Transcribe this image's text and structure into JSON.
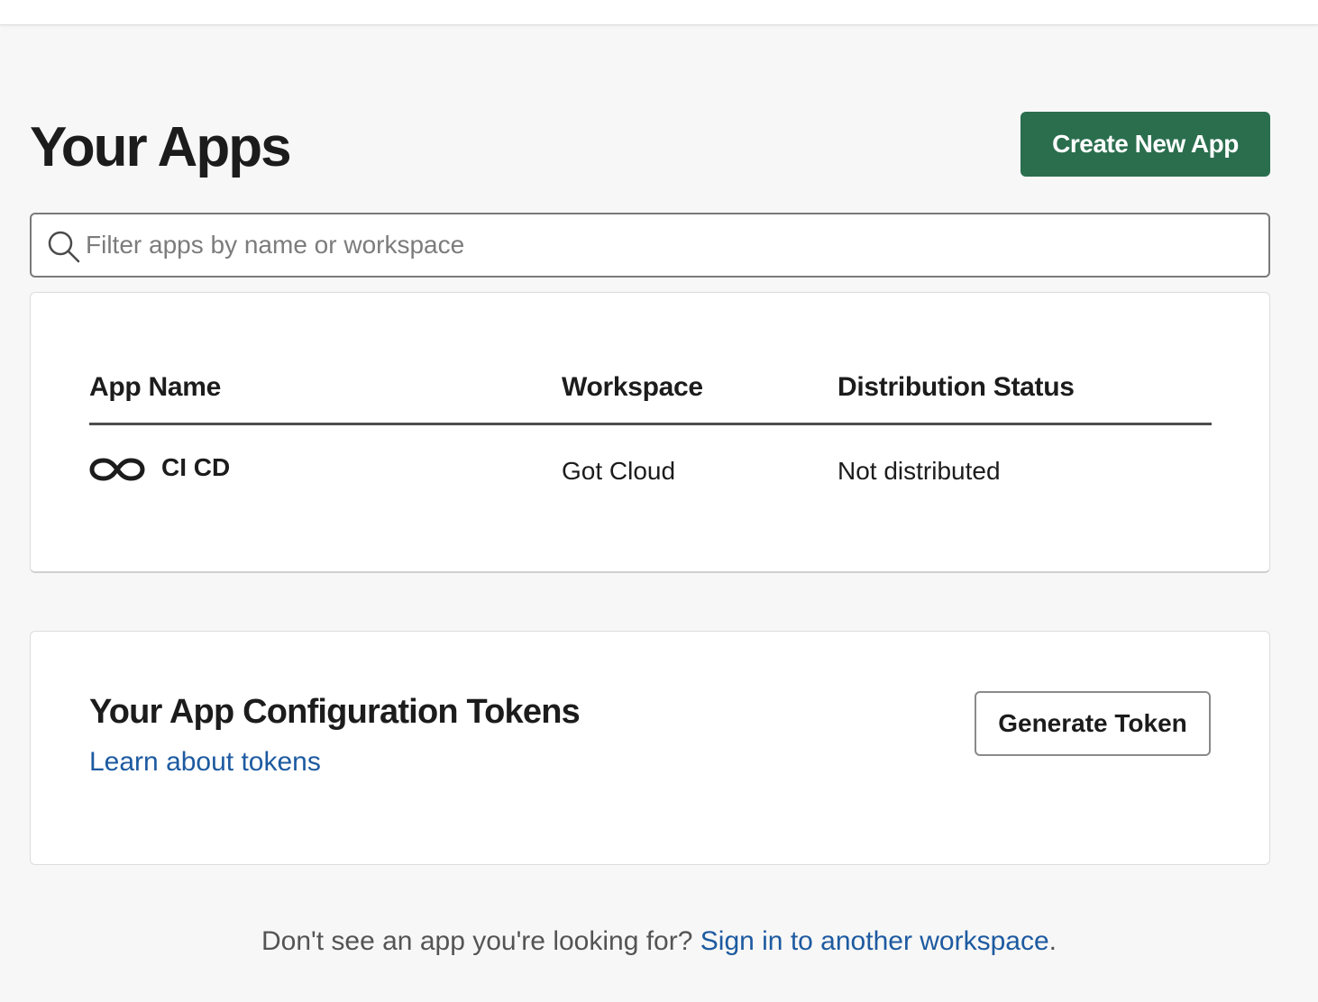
{
  "page": {
    "title": "Your Apps",
    "create_button_label": "Create New App"
  },
  "search": {
    "placeholder": "Filter apps by name or workspace",
    "value": "",
    "icon": "search-icon"
  },
  "apps_table": {
    "columns": [
      "App Name",
      "Workspace",
      "Distribution Status"
    ],
    "rows": [
      {
        "icon": "infinity-icon",
        "name": "CI CD",
        "workspace": "Got Cloud",
        "status": "Not distributed"
      }
    ]
  },
  "tokens": {
    "title": "Your App Configuration Tokens",
    "link_label": "Learn about tokens",
    "generate_label": "Generate Token"
  },
  "footer": {
    "text": "Don't see an app you're looking for?",
    "link_label": "Sign in to another workspace",
    "suffix": "."
  },
  "colors": {
    "primary_button": "#2a6e4e",
    "link": "#1d5aa0",
    "background": "#f7f7f7"
  }
}
